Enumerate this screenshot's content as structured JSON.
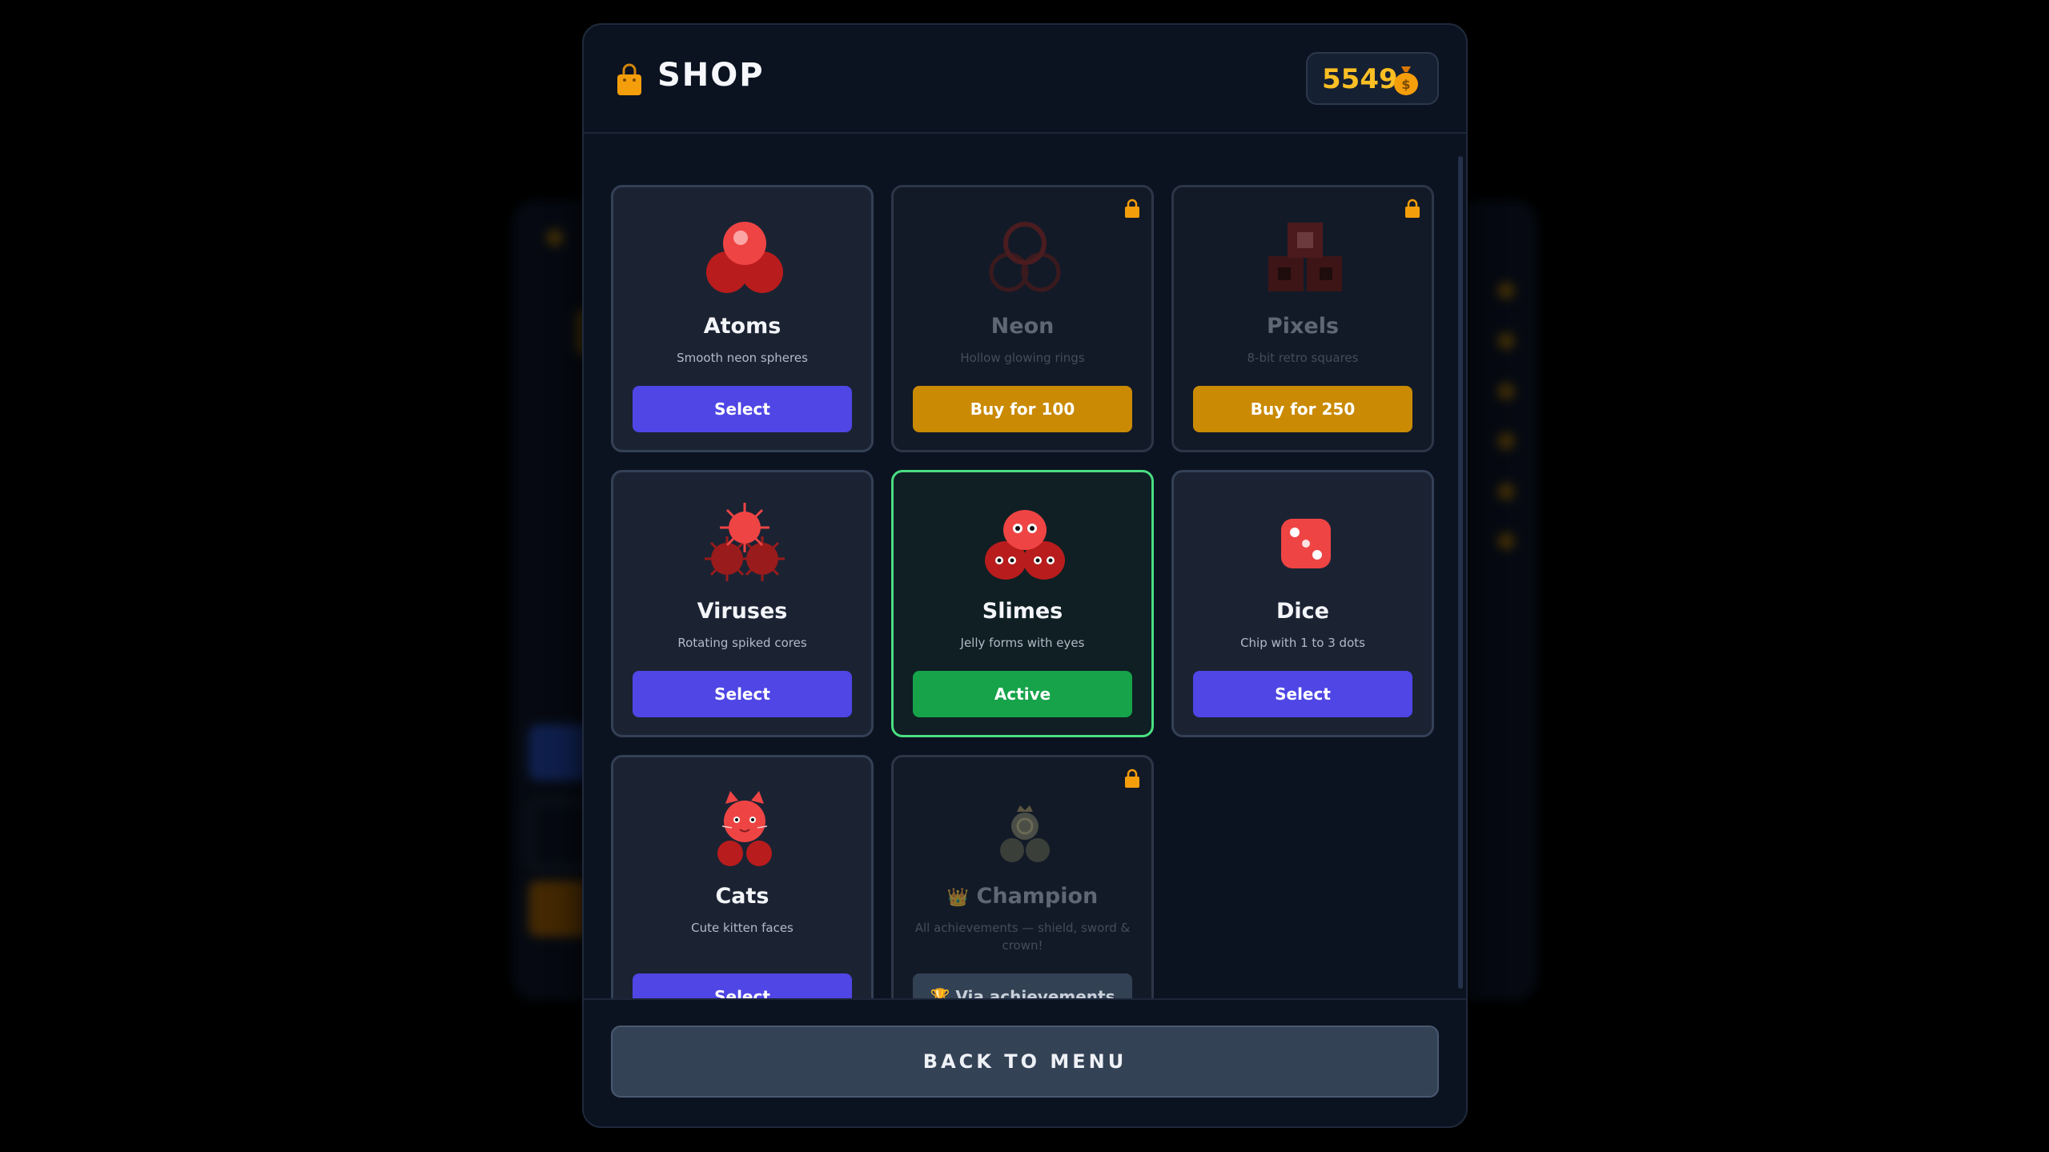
{
  "shop": {
    "title": "SHOP",
    "coins": "5549",
    "icons": {
      "title": "shopping-bag-icon",
      "coins": "money-bag-icon"
    }
  },
  "skins": [
    {
      "name": "Atoms",
      "desc": "Smooth neon spheres",
      "button": "Select",
      "state": "owned",
      "icon": "atoms-icon"
    },
    {
      "name": "Neon",
      "desc": "Hollow glowing rings",
      "button": "Buy for 100",
      "state": "locked",
      "icon": "neon-rings-icon"
    },
    {
      "name": "Pixels",
      "desc": "8-bit retro squares",
      "button": "Buy for 250",
      "state": "locked",
      "icon": "pixel-squares-icon"
    },
    {
      "name": "Viruses",
      "desc": "Rotating spiked cores",
      "button": "Select",
      "state": "owned",
      "icon": "virus-icon"
    },
    {
      "name": "Slimes",
      "desc": "Jelly forms with eyes",
      "button": "Active",
      "state": "active",
      "icon": "slime-icon"
    },
    {
      "name": "Dice",
      "desc": "Chip with 1 to 3 dots",
      "button": "Select",
      "state": "owned",
      "icon": "dice-icon"
    },
    {
      "name": "Cats",
      "desc": "Cute kitten faces",
      "button": "Select",
      "state": "owned",
      "icon": "cat-icon"
    },
    {
      "name": "Champion",
      "crown": "👑",
      "desc": "All achievements — shield, sword & crown!",
      "button": "🏆 Via achievements",
      "state": "locked",
      "icon": "champion-icon"
    }
  ],
  "footer": {
    "back_label": "BACK TO MENU"
  },
  "colors": {
    "accent": "#4f46e5",
    "buy": "#ca8a04",
    "active": "#16a34a",
    "coin": "#fbbf24"
  }
}
